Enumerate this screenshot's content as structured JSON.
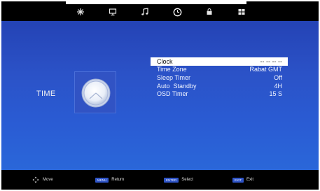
{
  "tabs": [
    {
      "icon": "picture-icon"
    },
    {
      "icon": "monitor-icon"
    },
    {
      "icon": "music-note-icon"
    },
    {
      "icon": "clock-icon",
      "active": true
    },
    {
      "icon": "lock-icon"
    },
    {
      "icon": "grid-icon"
    }
  ],
  "section": {
    "title": "TIME",
    "icon": "clock-icon"
  },
  "menu": {
    "items": [
      {
        "label": "Clock",
        "value": "-- -- -- --",
        "selected": true
      },
      {
        "label": "Time Zone",
        "value": "Rabat GMT",
        "selected": false
      },
      {
        "label": "Sleep Timer",
        "value": "Off",
        "selected": false
      },
      {
        "label": "Auto  Standby",
        "value": "4H",
        "selected": false
      },
      {
        "label": "OSD Timer",
        "value": "15 S",
        "selected": false
      }
    ]
  },
  "footer": {
    "move_label": "Move",
    "return_key": "MENU",
    "return_label": "Return",
    "select_key": "ENTER",
    "select_label": "Select",
    "exit_key": "EXIT",
    "exit_label": "Exit"
  },
  "colors": {
    "background_top": "#2443b5",
    "background_bottom": "#2a67d9",
    "selected_row": "#ffffff",
    "key_badge": "#2f54c7"
  }
}
